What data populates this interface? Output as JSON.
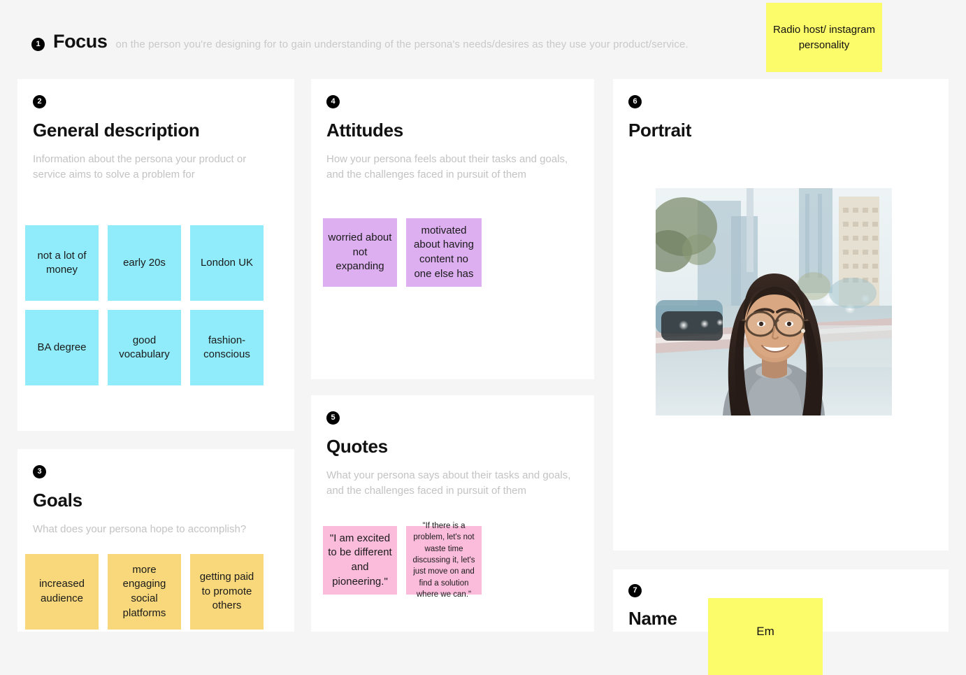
{
  "header": {
    "step": "1",
    "title": "Focus",
    "subtitle": "on the person you're designing for to gain understanding of the persona's needs/desires as they use your product/service.",
    "note": "Radio host/ instagram personality"
  },
  "colors": {
    "page_background": "#f5f5f5",
    "card_background": "#ffffff",
    "badge": "#000000",
    "note_yellow_bright": "#fcfc6a",
    "note_cyan": "#90ecfa",
    "note_gold": "#f8d87a",
    "note_purple": "#ddaff1",
    "note_pink": "#fbbcdc",
    "title_text": "#111111",
    "muted_text": "#c3c3c3"
  },
  "cards": {
    "general": {
      "step": "2",
      "title": "General description",
      "subtitle": "Information about the persona your product or service aims to solve a problem for",
      "notes": [
        "not a lot of money",
        "early 20s",
        "London UK",
        "BA degree",
        "good vocabulary",
        "fashion-conscious"
      ]
    },
    "goals": {
      "step": "3",
      "title": "Goals",
      "subtitle": "What does your persona hope to accomplish?",
      "notes": [
        "increased audience",
        "more engaging social platforms",
        "getting paid to promote others"
      ]
    },
    "attitudes": {
      "step": "4",
      "title": "Attitudes",
      "subtitle": "How your persona feels about their tasks and goals, and the challenges faced in pursuit of them",
      "notes": [
        "worried about not expanding",
        "motivated about having content no one else has"
      ]
    },
    "quotes": {
      "step": "5",
      "title": "Quotes",
      "subtitle": "What your persona says about their tasks and goals, and the challenges faced in pursuit of them",
      "notes": [
        "\"I am excited to be different and pioneering.\"",
        "\"If there is a problem, let's not waste time discussing it, let's just move on and find a solution where we can.\""
      ]
    },
    "portrait": {
      "step": "6",
      "title": "Portrait",
      "photo_alt": "smiling woman with glasses on a city street"
    },
    "name": {
      "step": "7",
      "title": "Name",
      "note": "Em"
    }
  }
}
